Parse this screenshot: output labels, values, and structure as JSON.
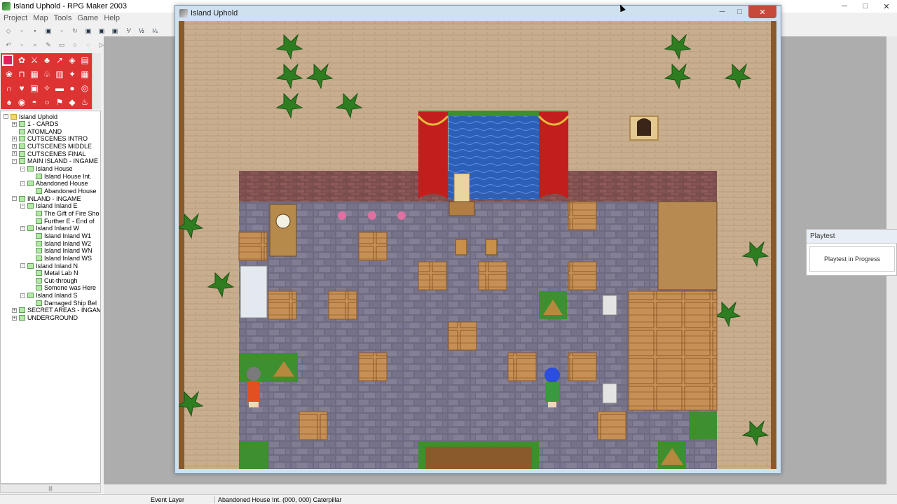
{
  "app": {
    "title": "Island Uphold - RPG Maker 2003",
    "controls": {
      "minimize": "─",
      "maximize": "□",
      "close": "✕"
    }
  },
  "menu": [
    "Project",
    "Map",
    "Tools",
    "Game",
    "Help"
  ],
  "tree": {
    "items": [
      {
        "label": "Island Uphold",
        "level": 0,
        "expander": "-",
        "folder": "yellow"
      },
      {
        "label": "1 - CARDS",
        "level": 1,
        "expander": "+",
        "folder": "green"
      },
      {
        "label": "ATOMLAND",
        "level": 1,
        "expander": "",
        "folder": "green"
      },
      {
        "label": "CUTSCENES INTRO",
        "level": 1,
        "expander": "+",
        "folder": "green"
      },
      {
        "label": "CUTSCENES MIDDLE",
        "level": 1,
        "expander": "+",
        "folder": "green"
      },
      {
        "label": "CUTSCENES FINAL",
        "level": 1,
        "expander": "+",
        "folder": "green"
      },
      {
        "label": "MAIN ISLAND - INGAME",
        "level": 1,
        "expander": "-",
        "folder": "green"
      },
      {
        "label": "Island House",
        "level": 2,
        "expander": "-",
        "folder": "green"
      },
      {
        "label": "Island House Int.",
        "level": 3,
        "expander": "",
        "folder": "green"
      },
      {
        "label": "Abandoned House",
        "level": 2,
        "expander": "-",
        "folder": "green"
      },
      {
        "label": "Abandoned House",
        "level": 3,
        "expander": "",
        "folder": "green"
      },
      {
        "label": "INLAND - INGAME",
        "level": 1,
        "expander": "-",
        "folder": "green"
      },
      {
        "label": "Island Inland E",
        "level": 2,
        "expander": "-",
        "folder": "green"
      },
      {
        "label": "The Gift of Fire Sho",
        "level": 3,
        "expander": "",
        "folder": "green"
      },
      {
        "label": "Further E - End of",
        "level": 3,
        "expander": "",
        "folder": "green"
      },
      {
        "label": "Island Inland W",
        "level": 2,
        "expander": "-",
        "folder": "green"
      },
      {
        "label": "Island Inland W1",
        "level": 3,
        "expander": "",
        "folder": "green"
      },
      {
        "label": "Island Inland W2",
        "level": 3,
        "expander": "",
        "folder": "green"
      },
      {
        "label": "Island Inland WN",
        "level": 3,
        "expander": "",
        "folder": "green"
      },
      {
        "label": "Island Inland WS",
        "level": 3,
        "expander": "",
        "folder": "green"
      },
      {
        "label": "Island Inland N",
        "level": 2,
        "expander": "-",
        "folder": "green"
      },
      {
        "label": "Metal Lab N",
        "level": 3,
        "expander": "",
        "folder": "green"
      },
      {
        "label": "Cut-through",
        "level": 3,
        "expander": "",
        "folder": "green"
      },
      {
        "label": "Somone was Here",
        "level": 3,
        "expander": "",
        "folder": "green"
      },
      {
        "label": "Island Inland S",
        "level": 2,
        "expander": "-",
        "folder": "green"
      },
      {
        "label": "Damaged Ship Bel",
        "level": 3,
        "expander": "",
        "folder": "green"
      },
      {
        "label": "SECRET AREAS - INGAME",
        "level": 1,
        "expander": "+",
        "folder": "green"
      },
      {
        "label": "UNDERGROUND",
        "level": 1,
        "expander": "+",
        "folder": "green"
      }
    ]
  },
  "playtest_window": {
    "title": "Island Uphold",
    "controls": {
      "minimize": "─",
      "maximize": "□",
      "close": "✕"
    }
  },
  "playtest_panel": {
    "title": "Playtest",
    "status": "Playtest in Progress"
  },
  "status": {
    "layer": "Event Layer",
    "info": "Abandoned House Int. (000, 000) Caterpillar"
  },
  "colors": {
    "floor_stone": "#6e6a80",
    "wall_brick": "#7a4d4d",
    "sand": "#c9ad8f",
    "water": "#2c5fb8",
    "curtain": "#c21e1e",
    "grass": "#3e8f2f",
    "crate": "#d1a064"
  }
}
